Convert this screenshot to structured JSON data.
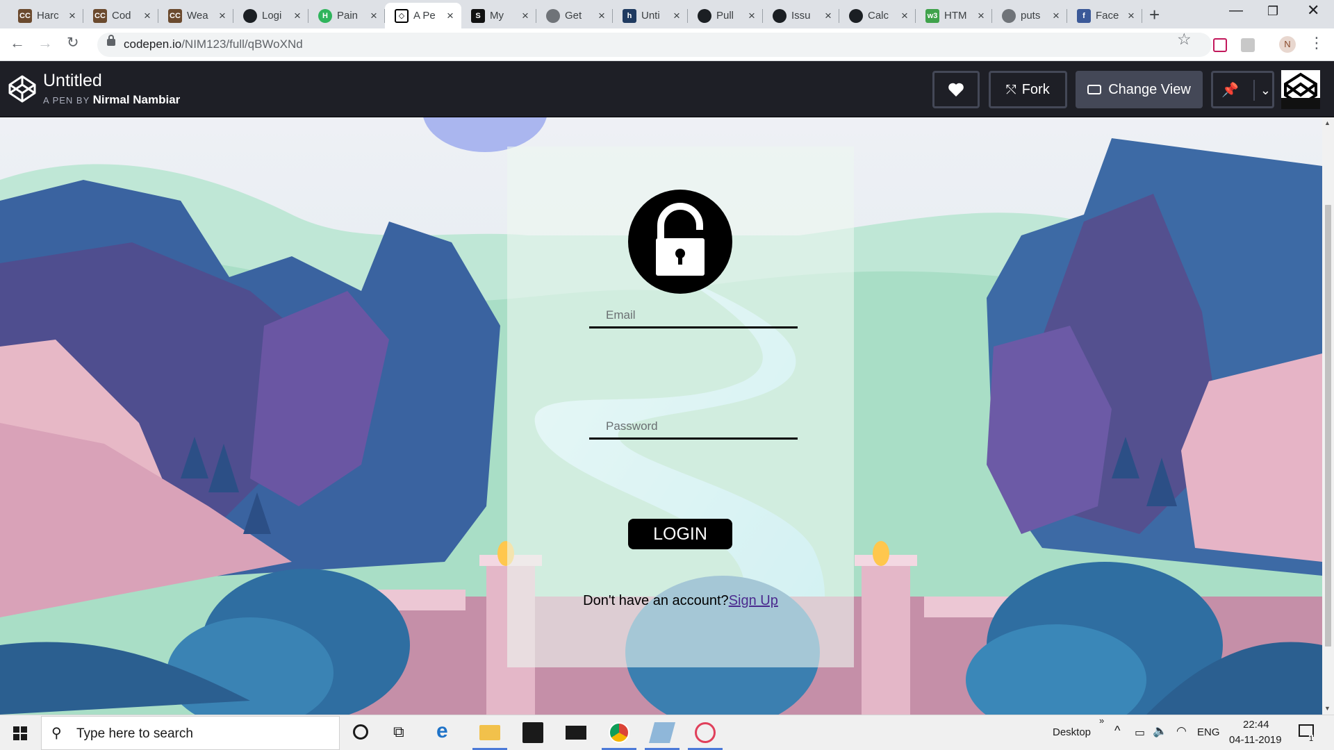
{
  "browser": {
    "tabs": [
      {
        "label": "Harc",
        "favicon": "cc-icon"
      },
      {
        "label": "Cod",
        "favicon": "cc-icon"
      },
      {
        "label": "Wea",
        "favicon": "cc-icon"
      },
      {
        "label": "Logi",
        "favicon": "github-icon"
      },
      {
        "label": "Pain",
        "favicon": "h-icon"
      },
      {
        "label": "A Pe",
        "favicon": "codepen-icon",
        "active": true
      },
      {
        "label": "My",
        "favicon": "s-icon"
      },
      {
        "label": "Get",
        "favicon": "globe-icon"
      },
      {
        "label": "Unti",
        "favicon": "h-dark-icon"
      },
      {
        "label": "Pull",
        "favicon": "github-icon"
      },
      {
        "label": "Issu",
        "favicon": "github-icon"
      },
      {
        "label": "Calc",
        "favicon": "github-icon"
      },
      {
        "label": "HTM",
        "favicon": "w3-icon"
      },
      {
        "label": "puts",
        "favicon": "globe-icon"
      },
      {
        "label": "Face",
        "favicon": "facebook-icon"
      }
    ],
    "url_host": "codepen.io",
    "url_path": "/NIM123/full/qBWoXNd",
    "profile_initial": "N"
  },
  "codepen": {
    "title": "Untitled",
    "byline_prefix": "A PEN BY",
    "author": "Nirmal Nambiar",
    "fork_label": "Fork",
    "change_view_label": "Change View"
  },
  "login": {
    "email_placeholder": "Email",
    "password_placeholder": "Password",
    "login_label": "LOGIN",
    "no_account_text": "Don't have an account?",
    "signup_label": "Sign Up"
  },
  "taskbar": {
    "search_placeholder": "Type here to search",
    "desktop_label": "Desktop",
    "language": "ENG",
    "time": "22:44",
    "date": "04-11-2019",
    "notification_count": "1"
  },
  "colors": {
    "accent_blue": "#1a73e8",
    "codepen_bar": "#1e1f26",
    "signup_link": "#4b2a8e"
  }
}
